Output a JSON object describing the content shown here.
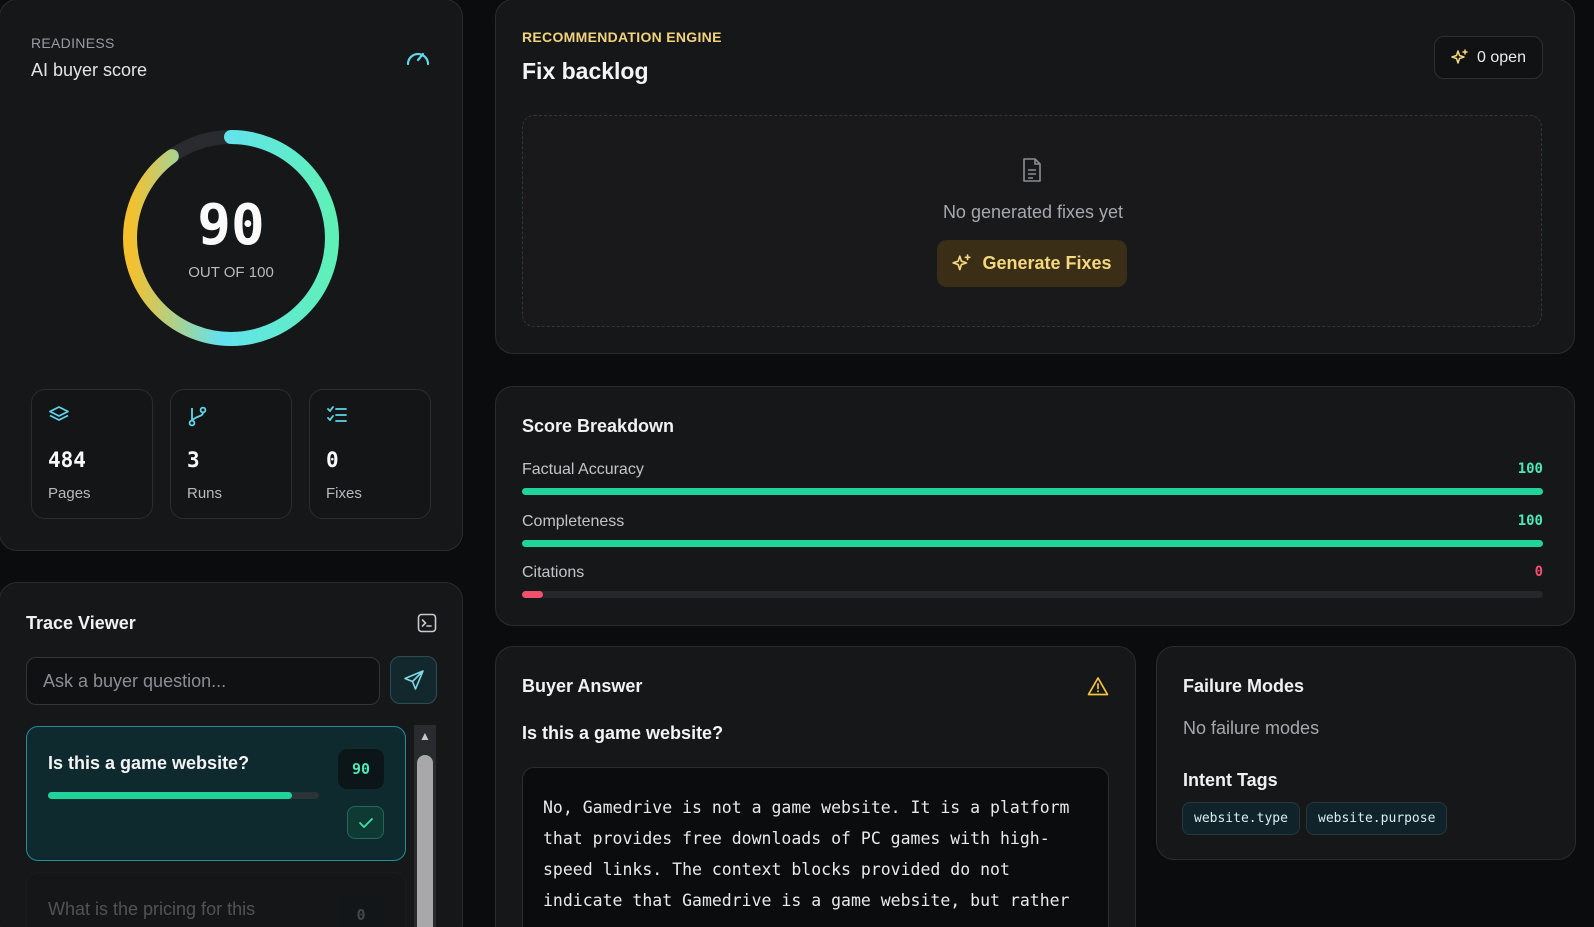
{
  "readiness": {
    "eyebrow": "READINESS",
    "subtitle": "AI buyer score",
    "score": "90",
    "score_caption": "OUT OF 100",
    "score_fraction": 0.9,
    "stats": [
      {
        "value": "484",
        "label": "Pages",
        "icon": "layers-icon"
      },
      {
        "value": "3",
        "label": "Runs",
        "icon": "git-branch-icon"
      },
      {
        "value": "0",
        "label": "Fixes",
        "icon": "list-checks-icon"
      }
    ]
  },
  "trace": {
    "title": "Trace Viewer",
    "input_placeholder": "Ask a buyer question...",
    "items": [
      {
        "question": "Is this a game website?",
        "score": "90",
        "progress": 0.9,
        "status": "passed"
      },
      {
        "question": "What is the pricing for this",
        "score": "0"
      }
    ]
  },
  "backlog": {
    "eyebrow": "RECOMMENDATION ENGINE",
    "title": "Fix backlog",
    "open_label": "0 open",
    "empty_message": "No generated fixes yet",
    "generate_label": "Generate Fixes"
  },
  "breakdown": {
    "title": "Score Breakdown",
    "metrics": [
      {
        "name": "Factual Accuracy",
        "value": "100",
        "fraction": 1.0,
        "color": "#20d39a"
      },
      {
        "name": "Completeness",
        "value": "100",
        "fraction": 1.0,
        "color": "#20d39a"
      },
      {
        "name": "Citations",
        "value": "0",
        "fraction": 0.0,
        "color": "#f0506e"
      }
    ]
  },
  "answer": {
    "title": "Buyer Answer",
    "question": "Is this a game website?",
    "text": "No, Gamedrive is not a game website. It is a platform that provides free downloads of PC games with high-speed links. The context blocks provided do not indicate that Gamedrive is a game website, but rather"
  },
  "failure": {
    "title": "Failure Modes",
    "empty_message": "No failure modes",
    "intent_title": "Intent Tags",
    "tags": [
      "website.type",
      "website.purpose"
    ]
  },
  "colors": {
    "accent_teal": "#20d39a",
    "accent_gold": "#f5c02e",
    "accent_red": "#f0506e"
  }
}
